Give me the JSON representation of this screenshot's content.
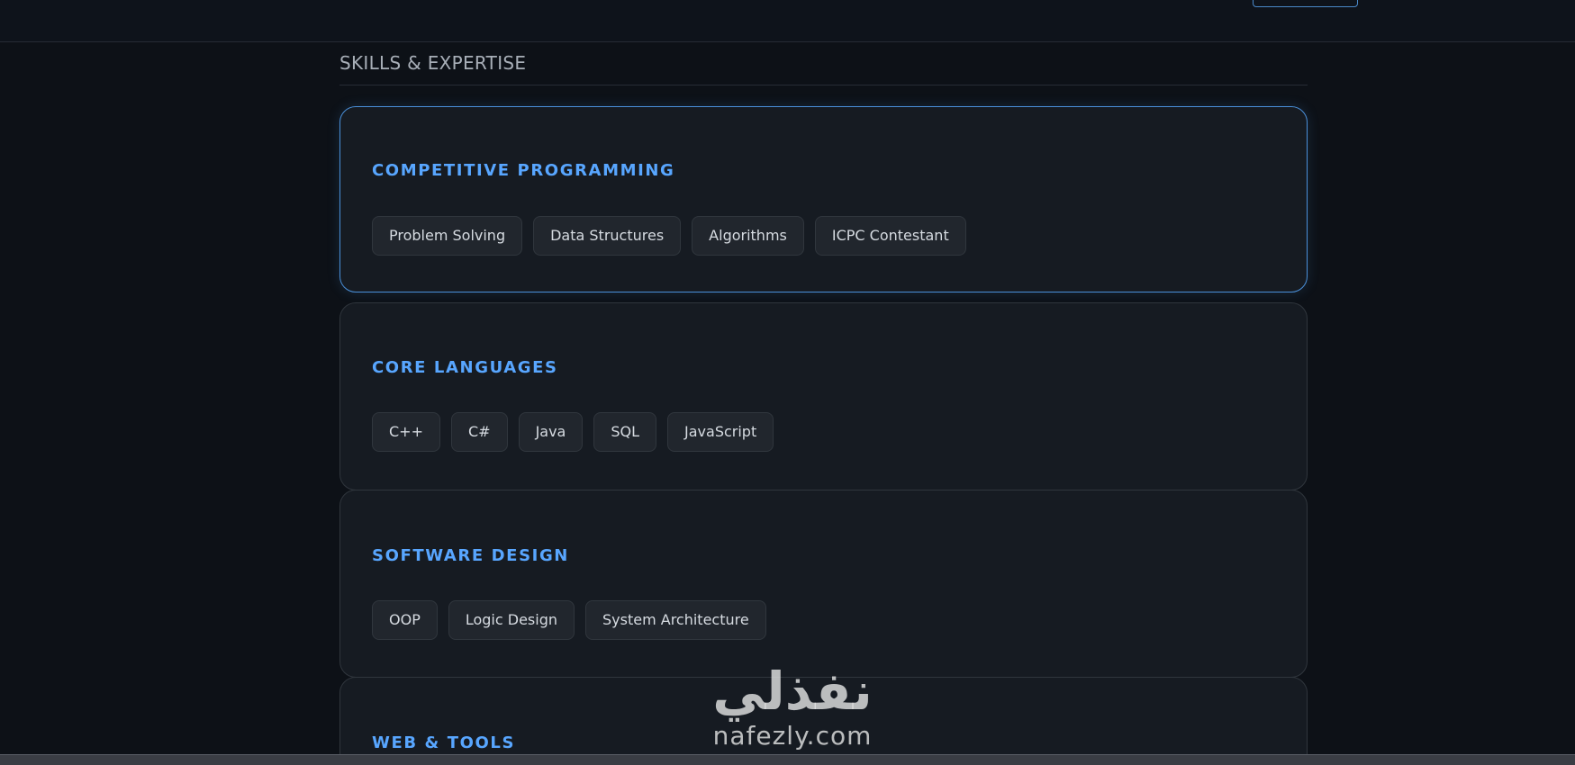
{
  "section": {
    "title": "SKILLS & EXPERTISE"
  },
  "cards": [
    {
      "title": "COMPETITIVE PROGRAMMING",
      "tags": [
        "Problem Solving",
        "Data Structures",
        "Algorithms",
        "ICPC Contestant"
      ]
    },
    {
      "title": "CORE LANGUAGES",
      "tags": [
        "C++",
        "C#",
        "Java",
        "SQL",
        "JavaScript"
      ]
    },
    {
      "title": "SOFTWARE DESIGN",
      "tags": [
        "OOP",
        "Logic Design",
        "System Architecture"
      ]
    },
    {
      "title": "WEB & TOOLS",
      "tags": []
    }
  ],
  "watermark": {
    "arabic": "نفذلي",
    "latin": "nafezly.com"
  },
  "colors": {
    "background": "#0d1117",
    "card": "#161b22",
    "accent": "#58a6ff",
    "active_border": "#4a90d9",
    "tag_bg": "#21262d"
  }
}
